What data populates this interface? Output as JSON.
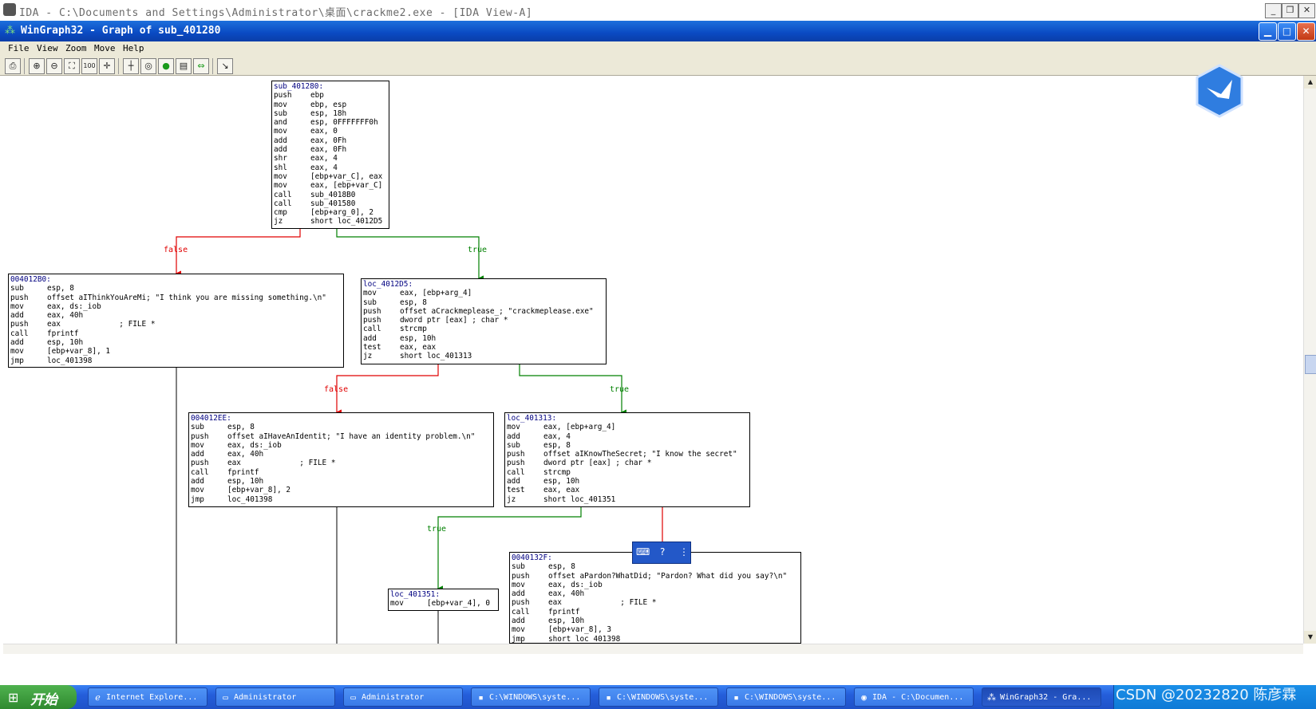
{
  "ida_window": {
    "title": "IDA - C:\\Documents and Settings\\Administrator\\桌面\\crackme2.exe - [IDA View-A]"
  },
  "graph_window": {
    "title": "WinGraph32 - Graph of sub_401280"
  },
  "menu": [
    "File",
    "View",
    "Zoom",
    "Move",
    "Help"
  ],
  "toolbar": {
    "buttons": [
      "print-icon",
      "zoom-in-icon",
      "zoom-out-icon",
      "fit-icon",
      "zoom-100-icon",
      "center-icon",
      "origin-icon",
      "circle-icon",
      "globe-icon",
      "layout-icon",
      "arrow-icon",
      "select-icon"
    ],
    "zoom_100_label": "100"
  },
  "nodes": [
    {
      "id": "n1",
      "label": "sub_401280:",
      "lines": [
        [
          "push",
          "ebp"
        ],
        [
          "mov",
          "ebp, esp"
        ],
        [
          "sub",
          "esp, 18h"
        ],
        [
          "and",
          "esp, 0FFFFFFF0h"
        ],
        [
          "mov",
          "eax, 0"
        ],
        [
          "add",
          "eax, 0Fh"
        ],
        [
          "add",
          "eax, 0Fh"
        ],
        [
          "shr",
          "eax, 4"
        ],
        [
          "shl",
          "eax, 4"
        ],
        [
          "mov",
          "[ebp+var_C], eax"
        ],
        [
          "mov",
          "eax, [ebp+var_C]"
        ],
        [
          "call",
          "sub_4018B0"
        ],
        [
          "call",
          "sub_401580"
        ],
        [
          "cmp",
          "[ebp+arg_0], 2"
        ],
        [
          "jz",
          "short loc_4012D5"
        ]
      ]
    },
    {
      "id": "n2",
      "label": "004012B0:",
      "lines": [
        [
          "sub",
          "esp, 8"
        ],
        [
          "push",
          "offset aIThinkYouAreMi; \"I think you are missing something.\\n\""
        ],
        [
          "mov",
          "eax, ds:_iob"
        ],
        [
          "add",
          "eax, 40h"
        ],
        [
          "push",
          "eax             ; FILE *"
        ],
        [
          "call",
          "fprintf"
        ],
        [
          "add",
          "esp, 10h"
        ],
        [
          "mov",
          "[ebp+var_8], 1"
        ],
        [
          "jmp",
          "loc_401398"
        ]
      ]
    },
    {
      "id": "n3",
      "label": "loc_4012D5:",
      "lines": [
        [
          "mov",
          "eax, [ebp+arg_4]"
        ],
        [
          "sub",
          "esp, 8"
        ],
        [
          "push",
          "offset aCrackmeplease_; \"crackmeplease.exe\""
        ],
        [
          "push",
          "dword ptr [eax] ; char *"
        ],
        [
          "call",
          "strcmp"
        ],
        [
          "add",
          "esp, 10h"
        ],
        [
          "test",
          "eax, eax"
        ],
        [
          "jz",
          "short loc_401313"
        ]
      ]
    },
    {
      "id": "n4",
      "label": "004012EE:",
      "lines": [
        [
          "sub",
          "esp, 8"
        ],
        [
          "push",
          "offset aIHaveAnIdentit; \"I have an identity problem.\\n\""
        ],
        [
          "mov",
          "eax, ds:_iob"
        ],
        [
          "add",
          "eax, 40h"
        ],
        [
          "push",
          "eax             ; FILE *"
        ],
        [
          "call",
          "fprintf"
        ],
        [
          "add",
          "esp, 10h"
        ],
        [
          "mov",
          "[ebp+var_8], 2"
        ],
        [
          "jmp",
          "loc_401398"
        ]
      ]
    },
    {
      "id": "n5",
      "label": "loc_401313:",
      "lines": [
        [
          "mov",
          "eax, [ebp+arg_4]"
        ],
        [
          "add",
          "eax, 4"
        ],
        [
          "sub",
          "esp, 8"
        ],
        [
          "push",
          "offset aIKnowTheSecret; \"I know the secret\""
        ],
        [
          "push",
          "dword ptr [eax] ; char *"
        ],
        [
          "call",
          "strcmp"
        ],
        [
          "add",
          "esp, 10h"
        ],
        [
          "test",
          "eax, eax"
        ],
        [
          "jz",
          "short loc_401351"
        ]
      ]
    },
    {
      "id": "n6",
      "label": "0040132F:",
      "lines": [
        [
          "sub",
          "esp, 8"
        ],
        [
          "push",
          "offset aPardon?WhatDid; \"Pardon? What did you say?\\n\""
        ],
        [
          "mov",
          "eax, ds:_iob"
        ],
        [
          "add",
          "eax, 40h"
        ],
        [
          "push",
          "eax             ; FILE *"
        ],
        [
          "call",
          "fprintf"
        ],
        [
          "add",
          "esp, 10h"
        ],
        [
          "mov",
          "[ebp+var_8], 3"
        ],
        [
          "jmp",
          "short loc_401398"
        ]
      ]
    },
    {
      "id": "n7",
      "label": "loc_401351:",
      "lines": [
        [
          "mov",
          "[ebp+var_4], 0"
        ]
      ]
    }
  ],
  "edge_labels": {
    "e1_false": "false",
    "e1_true": "true",
    "e2_false": "false",
    "e2_true": "true",
    "e3_true": "true"
  },
  "colors": {
    "false_edge": "#e00000",
    "true_edge": "#008000",
    "node_label": "#000080"
  },
  "taskbar": {
    "start_label": "开始",
    "tasks": [
      {
        "label": "Internet Explore...",
        "icon": "ie-icon"
      },
      {
        "label": "Administrator",
        "icon": "folder-icon"
      },
      {
        "label": "Administrator",
        "icon": "folder-icon"
      },
      {
        "label": "C:\\WINDOWS\\syste...",
        "icon": "console-icon"
      },
      {
        "label": "C:\\WINDOWS\\syste...",
        "icon": "console-icon"
      },
      {
        "label": "C:\\WINDOWS\\syste...",
        "icon": "console-icon"
      },
      {
        "label": "IDA - C:\\Documen...",
        "icon": "ida-icon"
      },
      {
        "label": "WinGraph32 - Gra...",
        "icon": "graph-icon"
      }
    ]
  },
  "watermark": "CSDN @20232820 陈彦霖"
}
